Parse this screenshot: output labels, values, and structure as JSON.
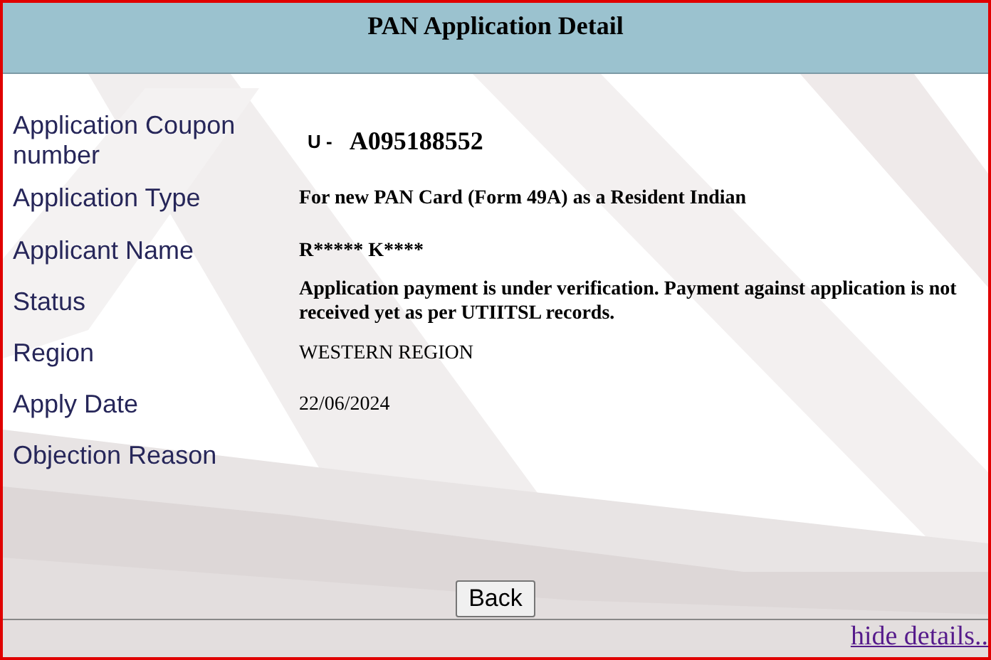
{
  "title": "PAN Application Detail",
  "rows": [
    {
      "label": "Application Coupon number",
      "kind": "coupon",
      "prefix": "U -",
      "value": "A095188552"
    },
    {
      "label": "Application Type",
      "kind": "bold",
      "value": "For new PAN Card (Form 49A) as a Resident Indian"
    },
    {
      "label": "Applicant Name",
      "kind": "bold",
      "value": "R***** K****"
    },
    {
      "label": "Status",
      "kind": "bold",
      "value": "Application payment is under verification. Payment against application is not received yet as per UTIITSL records."
    },
    {
      "label": "Region",
      "kind": "plain",
      "value": "WESTERN REGION"
    },
    {
      "label": "Apply Date",
      "kind": "plain",
      "value": "22/06/2024"
    },
    {
      "label": "Objection Reason",
      "kind": "empty"
    }
  ],
  "back_button": "Back",
  "link": "hide details.."
}
